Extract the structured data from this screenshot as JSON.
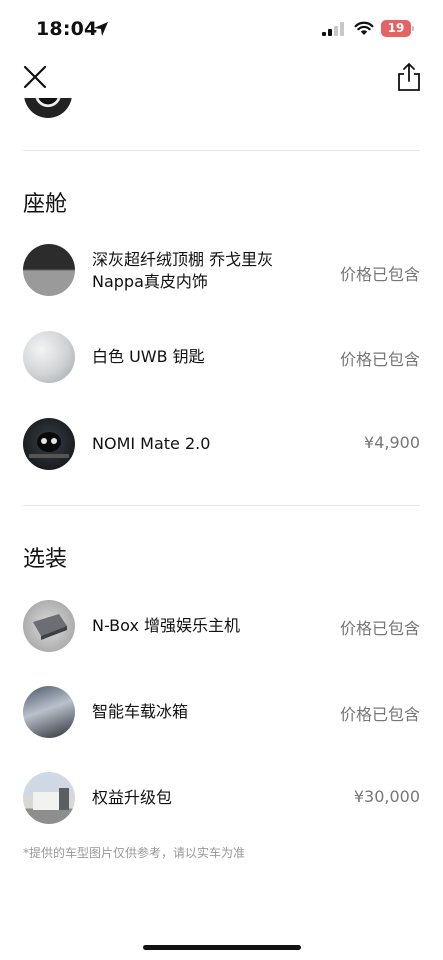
{
  "status_bar": {
    "time": "18:04",
    "battery": "19"
  },
  "sections": [
    {
      "title": "座舱",
      "items": [
        {
          "name_line1": "深灰超纤绒顶棚 乔戈里灰",
          "name_line2": "Nappa真皮内饰",
          "price": "价格已包含",
          "icon": "headliner-swatch"
        },
        {
          "name_line1": "白色 UWB 钥匙",
          "price": "价格已包含",
          "icon": "uwb-key"
        },
        {
          "name_line1": "NOMI Mate 2.0",
          "price": "¥4,900",
          "icon": "nomi-mate"
        }
      ]
    },
    {
      "title": "选装",
      "items": [
        {
          "name_line1": "N-Box 增强娱乐主机",
          "price": "价格已包含",
          "icon": "nbox"
        },
        {
          "name_line1": "智能车载冰箱",
          "price": "价格已包含",
          "icon": "car-fridge"
        },
        {
          "name_line1": "权益升级包",
          "price": "¥30,000",
          "icon": "benefits-pack"
        }
      ]
    }
  ],
  "footnote": "*提供的车型图片仅供参考，请以实车为准"
}
